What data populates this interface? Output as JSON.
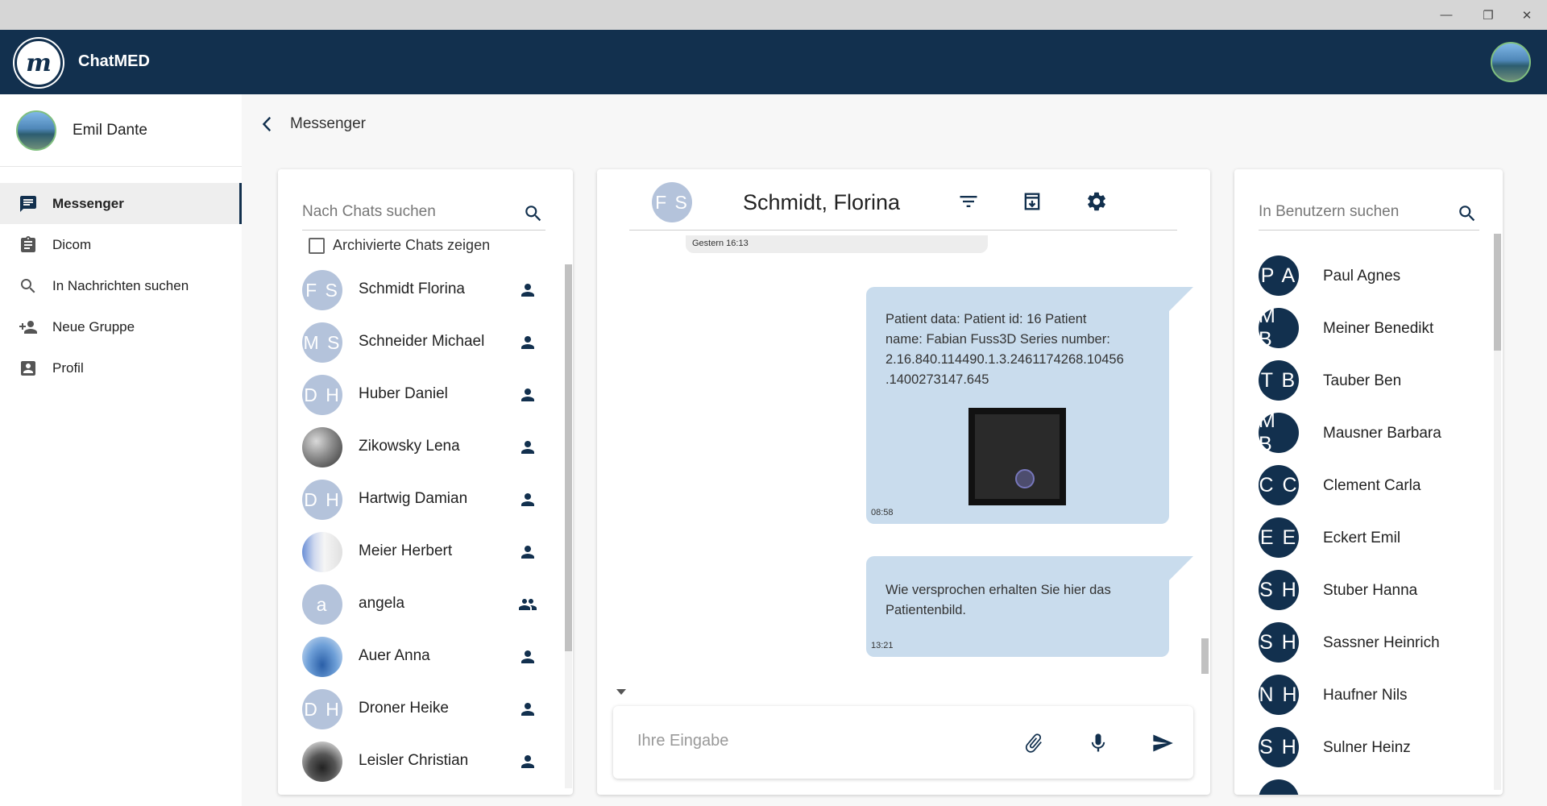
{
  "window": {
    "minimize_glyph": "—",
    "restore_glyph": "❐",
    "close_glyph": "✕"
  },
  "app": {
    "logo_letter": "m",
    "title": "ChatMED"
  },
  "user": {
    "name": "Emil Dante"
  },
  "nav": [
    {
      "label": "Messenger",
      "icon": "chat-icon",
      "active": true
    },
    {
      "label": "Dicom",
      "icon": "clipboard-icon",
      "active": false
    },
    {
      "label": "In Nachrichten suchen",
      "icon": "search-icon",
      "active": false
    },
    {
      "label": "Neue Gruppe",
      "icon": "add-person-icon",
      "active": false
    },
    {
      "label": "Profil",
      "icon": "account-box-icon",
      "active": false
    }
  ],
  "breadcrumb": {
    "title": "Messenger"
  },
  "chats": {
    "search_placeholder": "Nach Chats suchen",
    "archive_label": "Archivierte Chats zeigen",
    "items": [
      {
        "initials": "F S",
        "name": "Schmidt Florina",
        "type": "person",
        "avatar": "initials"
      },
      {
        "initials": "M S",
        "name": "Schneider Michael",
        "type": "person",
        "avatar": "initials"
      },
      {
        "initials": "D H",
        "name": "Huber Daniel",
        "type": "person",
        "avatar": "initials"
      },
      {
        "initials": "",
        "name": "Zikowsky Lena",
        "type": "person",
        "avatar": "photo-sphere"
      },
      {
        "initials": "D H",
        "name": "Hartwig Damian",
        "type": "person",
        "avatar": "initials"
      },
      {
        "initials": "",
        "name": "Meier Herbert",
        "type": "person",
        "avatar": "photo-document"
      },
      {
        "initials": "a",
        "name": "angela",
        "type": "group",
        "avatar": "initials"
      },
      {
        "initials": "",
        "name": "Auer Anna",
        "type": "person",
        "avatar": "photo-whale"
      },
      {
        "initials": "D H",
        "name": "Droner Heike",
        "type": "person",
        "avatar": "initials"
      },
      {
        "initials": "",
        "name": "Leisler Christian",
        "type": "person",
        "avatar": "photo-car"
      }
    ]
  },
  "conversation": {
    "initials": "F S",
    "title": "Schmidt, Florina",
    "previous_time": "Gestern 16:13",
    "messages": [
      {
        "text_lines": [
          "Patient data: Patient id: 16 Patient",
          "name: Fabian Fuss3D Series number:",
          "2.16.840.114490.1.3.2461174268.10456",
          ".1400273147.645"
        ],
        "time": "08:58",
        "has_image": true
      },
      {
        "text_lines": [
          "Wie versprochen erhalten Sie hier das",
          "Patientenbild."
        ],
        "time": "13:21",
        "has_image": false
      }
    ],
    "input_placeholder": "Ihre Eingabe"
  },
  "users": {
    "search_placeholder": "In Benutzern suchen",
    "items": [
      {
        "initials": "P A",
        "name": "Paul Agnes"
      },
      {
        "initials": "M B",
        "name": "Meiner Benedikt"
      },
      {
        "initials": "T B",
        "name": "Tauber Ben"
      },
      {
        "initials": "M B",
        "name": "Mausner Barbara"
      },
      {
        "initials": "C C",
        "name": "Clement Carla"
      },
      {
        "initials": "E E",
        "name": "Eckert Emil"
      },
      {
        "initials": "S H",
        "name": "Stuber Hanna"
      },
      {
        "initials": "S H",
        "name": "Sassner Heinrich"
      },
      {
        "initials": "N H",
        "name": "Haufner Nils"
      },
      {
        "initials": "S H",
        "name": "Sulner Heinz"
      }
    ]
  },
  "colors": {
    "brand_dark": "#12304e",
    "initials_light": "#b4c3db",
    "bubble": "#c9dced"
  }
}
